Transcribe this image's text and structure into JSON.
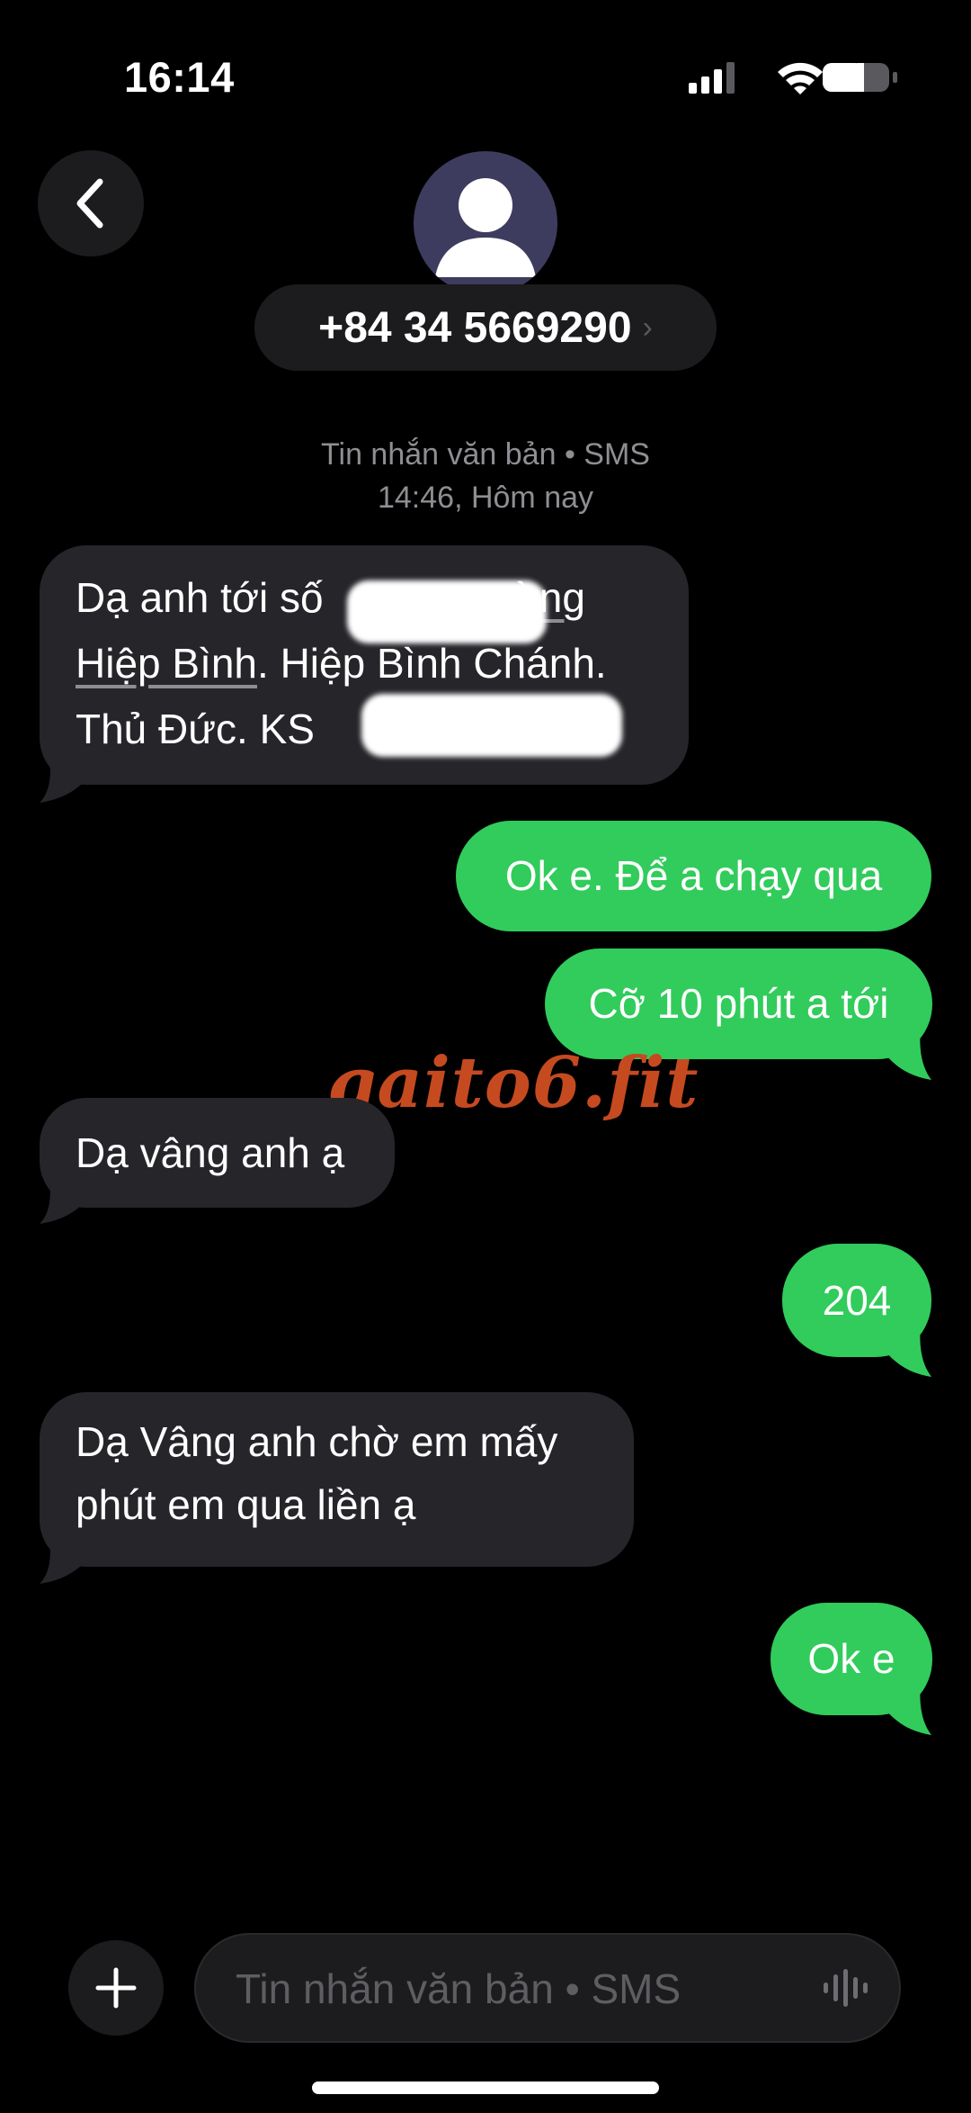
{
  "status_bar": {
    "time": "16:14",
    "signal_icon": "cellular-signal-icon",
    "wifi_icon": "wifi-icon",
    "battery_icon": "battery-icon"
  },
  "header": {
    "back_icon": "chevron-left-icon",
    "avatar_icon": "person-silhouette-icon",
    "contact": "+84 34 5669290",
    "contact_chevron": "›"
  },
  "thread_meta": {
    "type": "Tin nhắn văn bản • SMS",
    "timestamp": "14:46, Hôm nay"
  },
  "messages": [
    {
      "direction": "incoming",
      "lines": [
        "Dạ anh tới số",
        "ờng",
        "Hiệp Bình",
        ". Hiệp Bình Chánh.",
        "Thủ Đức. KS",
        "."
      ],
      "redacted": true
    },
    {
      "direction": "outgoing",
      "text": "Ok e. Để a chạy qua"
    },
    {
      "direction": "outgoing",
      "text": "Cỡ 10 phút a tới"
    },
    {
      "direction": "incoming",
      "text": "Dạ vâng anh ạ"
    },
    {
      "direction": "outgoing",
      "text": "204"
    },
    {
      "direction": "incoming",
      "lines": [
        "Dạ Vâng anh chờ em mấy",
        "phút em qua liền ạ"
      ]
    },
    {
      "direction": "outgoing",
      "text": "Ok e"
    }
  ],
  "watermark": "gaito6.fit",
  "composer": {
    "plus_icon": "plus-icon",
    "placeholder": "Tin nhắn văn bản • SMS",
    "mic_icon": "audio-waveform-icon"
  },
  "colors": {
    "incoming_bubble": "#26252a",
    "outgoing_bubble": "#31cc5b",
    "background": "#000000",
    "watermark": "#c54a20"
  }
}
